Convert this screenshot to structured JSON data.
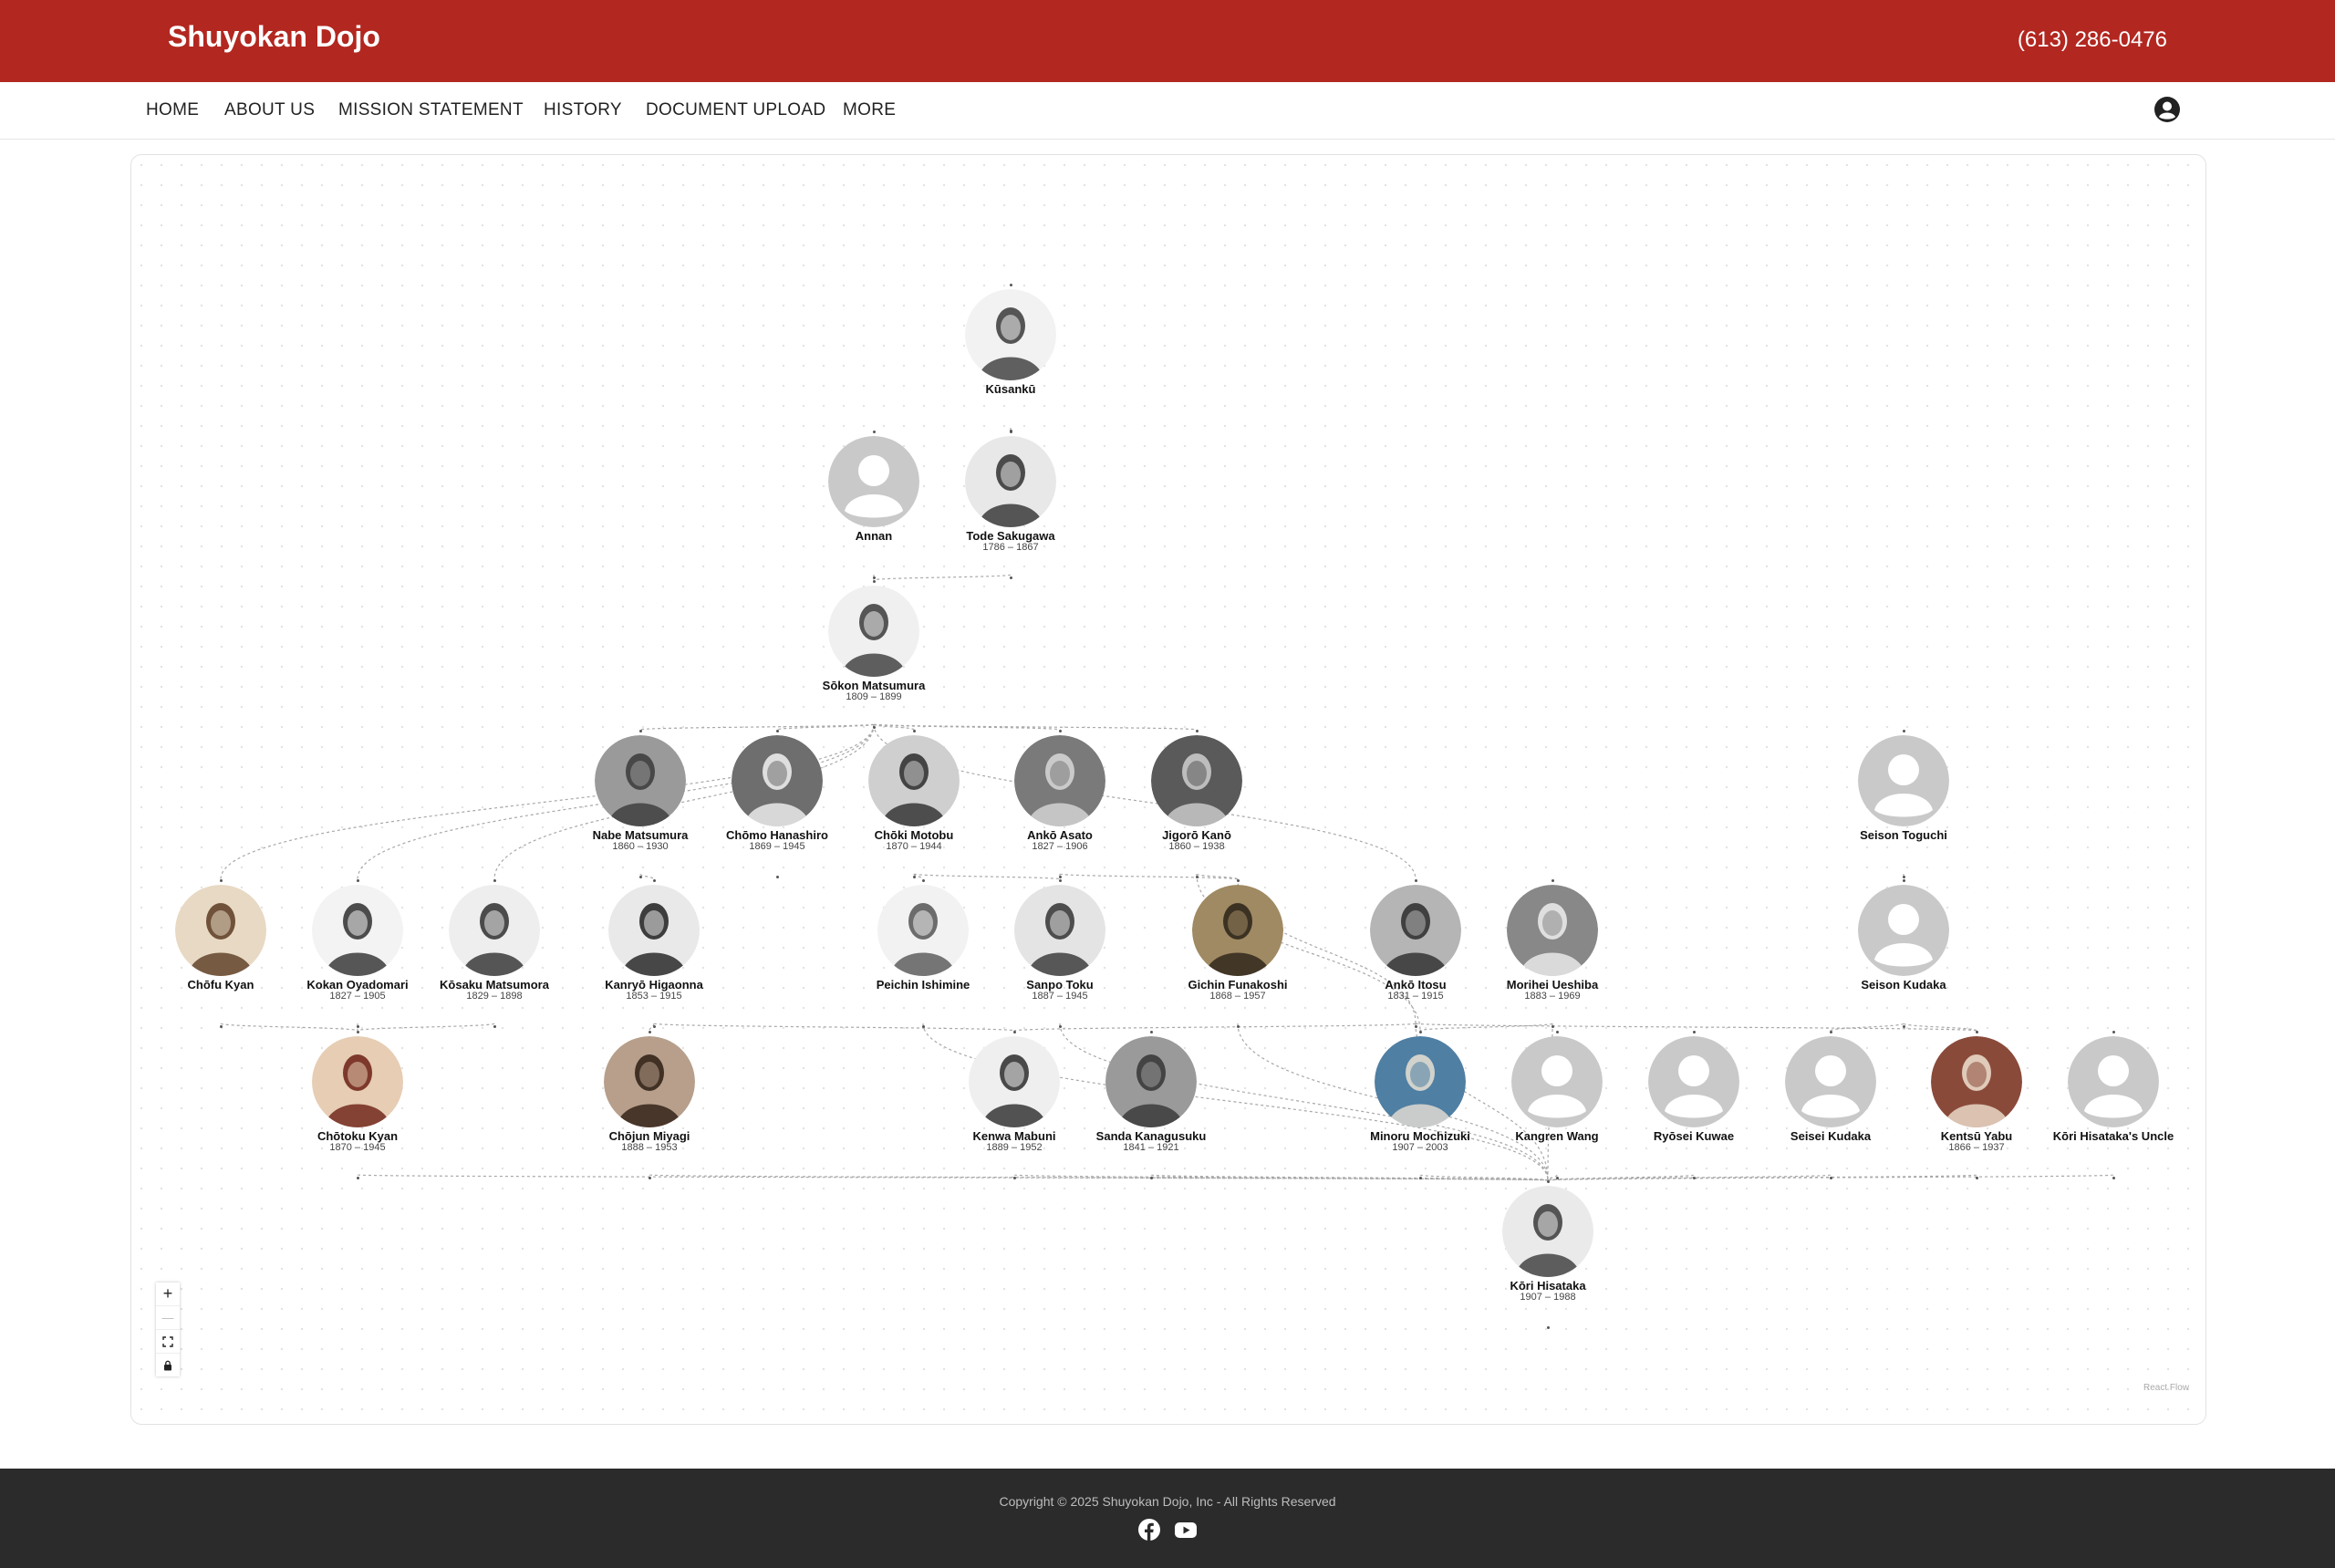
{
  "header": {
    "brand": "Shuyokan Dojo",
    "phone": "(613) 286-0476"
  },
  "nav": {
    "items": [
      "HOME",
      "ABOUT US",
      "MISSION STATEMENT",
      "HISTORY",
      "DOCUMENT UPLOAD",
      "MORE"
    ],
    "account_icon": "account-circle-icon"
  },
  "lineage": {
    "nodes": [
      {
        "id": "kusanku",
        "name": "Kūsankū",
        "dates": "",
        "portrait": "drawing"
      },
      {
        "id": "annan",
        "name": "Annan",
        "dates": "",
        "portrait": "placeholder"
      },
      {
        "id": "sakugawa",
        "name": "Tode Sakugawa",
        "dates": "1786 – 1867",
        "portrait": "drawing"
      },
      {
        "id": "sokon",
        "name": "Sōkon Matsumura",
        "dates": "1809 – 1899",
        "portrait": "drawing"
      },
      {
        "id": "nabe",
        "name": "Nabe Matsumura",
        "dates": "1860 – 1930",
        "portrait": "photo"
      },
      {
        "id": "chomo",
        "name": "Chōmo Hanashiro",
        "dates": "1869 – 1945",
        "portrait": "photo"
      },
      {
        "id": "choki",
        "name": "Chōki Motobu",
        "dates": "1870 – 1944",
        "portrait": "photo"
      },
      {
        "id": "anko_asato",
        "name": "Ankō Asato",
        "dates": "1827 – 1906",
        "portrait": "photo"
      },
      {
        "id": "jigoro",
        "name": "Jigorō Kanō",
        "dates": "1860 – 1938",
        "portrait": "photo"
      },
      {
        "id": "seison_toguchi",
        "name": "Seison Toguchi",
        "dates": "",
        "portrait": "placeholder"
      },
      {
        "id": "chofu",
        "name": "Chōfu Kyan",
        "dates": "",
        "portrait": "drawing"
      },
      {
        "id": "kokan",
        "name": "Kokan Oyadomari",
        "dates": "1827 – 1905",
        "portrait": "drawing"
      },
      {
        "id": "kosaku",
        "name": "Kōsaku Matsumora",
        "dates": "1829 – 1898",
        "portrait": "drawing"
      },
      {
        "id": "kanryo",
        "name": "Kanryō Higaonna",
        "dates": "1853 – 1915",
        "portrait": "photo"
      },
      {
        "id": "peichin",
        "name": "Peichin Ishimine",
        "dates": "",
        "portrait": "photo"
      },
      {
        "id": "sanpo",
        "name": "Sanpo Toku",
        "dates": "1887 – 1945",
        "portrait": "photo"
      },
      {
        "id": "gichin",
        "name": "Gichin Funakoshi",
        "dates": "1868 – 1957",
        "portrait": "photo"
      },
      {
        "id": "anko_itosu",
        "name": "Ankō Itosu",
        "dates": "1831 – 1915",
        "portrait": "photo"
      },
      {
        "id": "morihei",
        "name": "Morihei Ueshiba",
        "dates": "1883 – 1969",
        "portrait": "photo"
      },
      {
        "id": "seison_kudaka",
        "name": "Seison Kudaka",
        "dates": "",
        "portrait": "placeholder"
      },
      {
        "id": "chotoku",
        "name": "Chōtoku Kyan",
        "dates": "1870 – 1945",
        "portrait": "photo"
      },
      {
        "id": "chojun",
        "name": "Chōjun Miyagi",
        "dates": "1888 – 1953",
        "portrait": "photo"
      },
      {
        "id": "kenwa",
        "name": "Kenwa Mabuni",
        "dates": "1889 – 1952",
        "portrait": "photo"
      },
      {
        "id": "sanda",
        "name": "Sanda Kanagusuku",
        "dates": "1841 – 1921",
        "portrait": "photo"
      },
      {
        "id": "minoru",
        "name": "Minoru Mochizuki",
        "dates": "1907 – 2003",
        "portrait": "photo"
      },
      {
        "id": "kangren",
        "name": "Kangren Wang",
        "dates": "",
        "portrait": "placeholder"
      },
      {
        "id": "ryosei",
        "name": "Ryōsei Kuwae",
        "dates": "",
        "portrait": "placeholder"
      },
      {
        "id": "seisei",
        "name": "Seisei Kudaka",
        "dates": "",
        "portrait": "placeholder"
      },
      {
        "id": "kentsu",
        "name": "Kentsū Yabu",
        "dates": "1866 – 1937",
        "portrait": "photo"
      },
      {
        "id": "uncle",
        "name": "Kōri Hisataka's Uncle",
        "dates": "",
        "portrait": "placeholder"
      },
      {
        "id": "kori",
        "name": "Kōri Hisataka",
        "dates": "1907 – 1988",
        "portrait": "photo"
      }
    ],
    "edges": [
      [
        "kusanku",
        "sakugawa"
      ],
      [
        "sakugawa",
        "sokon"
      ],
      [
        "annan",
        "sokon"
      ],
      [
        "sokon",
        "nabe"
      ],
      [
        "sokon",
        "chomo"
      ],
      [
        "sokon",
        "choki"
      ],
      [
        "sokon",
        "anko_asato"
      ],
      [
        "sokon",
        "jigoro"
      ],
      [
        "sokon",
        "chofu"
      ],
      [
        "sokon",
        "kokan"
      ],
      [
        "sokon",
        "kosaku"
      ],
      [
        "sokon",
        "anko_itosu"
      ],
      [
        "nabe",
        "kanryo"
      ],
      [
        "choki",
        "sanpo"
      ],
      [
        "choki",
        "peichin"
      ],
      [
        "anko_asato",
        "gichin"
      ],
      [
        "anko_asato",
        "sanpo"
      ],
      [
        "jigoro",
        "minoru"
      ],
      [
        "jigoro",
        "gichin"
      ],
      [
        "anko_itosu",
        "gichin"
      ],
      [
        "anko_itosu",
        "kenwa"
      ],
      [
        "anko_itosu",
        "kentsu"
      ],
      [
        "morihei",
        "minoru"
      ],
      [
        "seison_toguchi",
        "seison_kudaka"
      ],
      [
        "seison_kudaka",
        "seisei"
      ],
      [
        "seison_kudaka",
        "kentsu"
      ],
      [
        "kokan",
        "chotoku"
      ],
      [
        "kosaku",
        "chotoku"
      ],
      [
        "chofu",
        "chotoku"
      ],
      [
        "kanryo",
        "chojun"
      ],
      [
        "kanryo",
        "kenwa"
      ],
      [
        "chotoku",
        "kori"
      ],
      [
        "chojun",
        "kori"
      ],
      [
        "kenwa",
        "kori"
      ],
      [
        "sanda",
        "kori"
      ],
      [
        "minoru",
        "kori"
      ],
      [
        "kangren",
        "kori"
      ],
      [
        "ryosei",
        "kori"
      ],
      [
        "seisei",
        "kori"
      ],
      [
        "kentsu",
        "kori"
      ],
      [
        "uncle",
        "kori"
      ],
      [
        "gichin",
        "kori"
      ],
      [
        "sanpo",
        "kori"
      ],
      [
        "peichin",
        "kori"
      ],
      [
        "morihei",
        "kori"
      ],
      [
        "anko_itosu",
        "kori"
      ]
    ]
  },
  "controls": {
    "zoom_in": "+",
    "zoom_out": "—",
    "fit_view": "fit-view-icon",
    "lock": "lock-icon"
  },
  "attribution": "React Flow",
  "footer": {
    "copyright": "Copyright © 2025 Shuyokan Dojo, Inc - All Rights Reserved",
    "social": [
      "facebook-icon",
      "youtube-icon"
    ]
  },
  "colors": {
    "header": "#b22720",
    "footer": "#2b2b2b",
    "placeholder_avatar": "#c9c9c9"
  }
}
